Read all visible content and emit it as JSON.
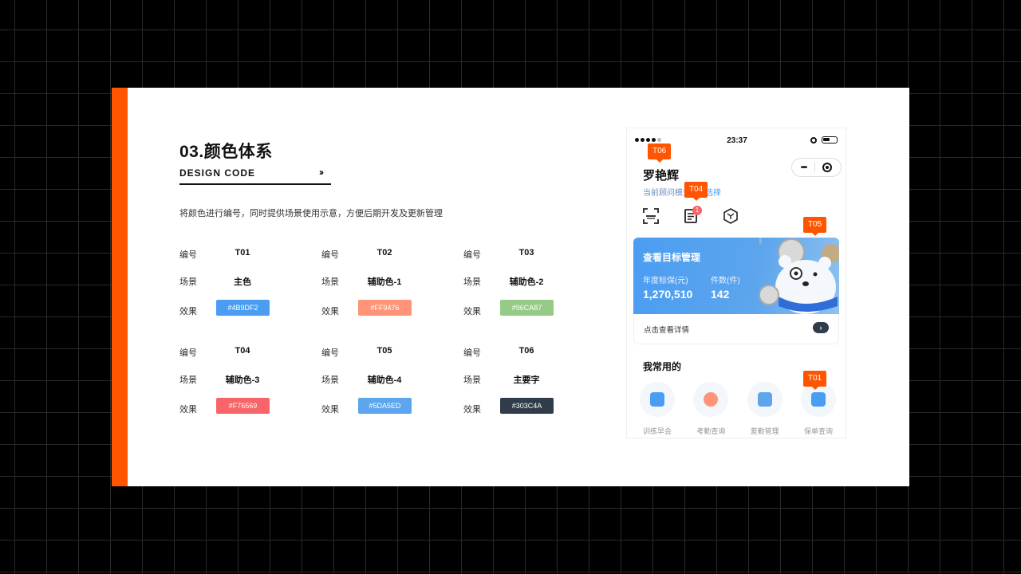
{
  "header": {
    "title": "03.颜色体系",
    "subtitle": "DESIGN CODE",
    "subtitle_arrow": "››",
    "description": "将颜色进行编号，同时提供场景使用示意，方便后期开发及更新管理"
  },
  "labels": {
    "code": "编号",
    "scene": "场景",
    "effect": "效果"
  },
  "colors": [
    {
      "code": "T01",
      "scene": "主色",
      "hex": "#4B9DF2"
    },
    {
      "code": "T02",
      "scene": "辅助色-1",
      "hex": "#FF9476"
    },
    {
      "code": "T03",
      "scene": "辅助色-2",
      "hex": "#96CA87"
    },
    {
      "code": "T04",
      "scene": "辅助色-3",
      "hex": "#F76569"
    },
    {
      "code": "T05",
      "scene": "辅助色-4",
      "hex": "#5DA5ED"
    },
    {
      "code": "T06",
      "scene": "主要字",
      "hex": "#303C4A"
    }
  ],
  "phone": {
    "status_time": "23:37",
    "user_name": "罗艳辉",
    "user_sub": "当前顾问模式",
    "user_sub_link": "选择",
    "badge_count": "1",
    "banner": {
      "title": "查看目标管理",
      "label1": "年度标保(元)",
      "value1": "1,270,510",
      "label2": "件数(件)",
      "value2": "142",
      "footer": "点击查看详情",
      "footer_btn": "›"
    },
    "section_title": "我常用的",
    "apps": [
      {
        "label": "训练早会",
        "color": "#4B9DF2"
      },
      {
        "label": "考勤查询",
        "color": "#FF9476"
      },
      {
        "label": "差勤管理",
        "color": "#5DA5ED"
      },
      {
        "label": "保单查询",
        "color": "#4B9DF2"
      }
    ]
  },
  "tags": {
    "t06": "T06",
    "t04": "T04",
    "t05": "T05",
    "t01": "T01"
  },
  "colors_theme": {
    "accent": "#FF5500",
    "background": "#000000",
    "card": "#FFFFFF"
  }
}
